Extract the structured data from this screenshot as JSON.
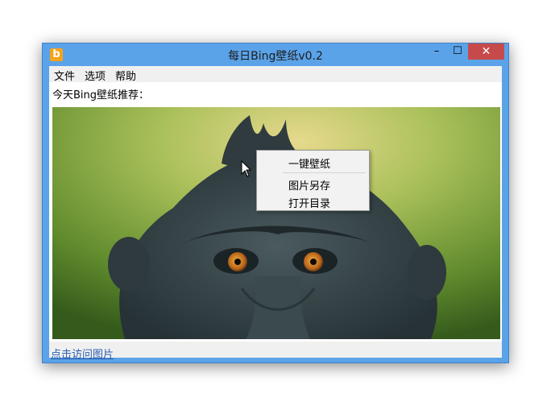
{
  "window": {
    "title": "每日Bing壁纸v0.2",
    "app_icon_letter": "b",
    "controls": {
      "minimize": "–",
      "maximize": "☐",
      "close": "✕"
    }
  },
  "menu": {
    "file": "文件",
    "options": "选项",
    "help": "帮助"
  },
  "main": {
    "today_label": "今天Bing壁纸推荐："
  },
  "status": {
    "link_text": "点击访问图片"
  },
  "context_menu": {
    "items": [
      "一键壁纸",
      "图片另存",
      "打开目录"
    ]
  },
  "colors": {
    "titlebar": "#5ba3e8",
    "close_button": "#c74a4a",
    "link": "#2a5db0"
  }
}
